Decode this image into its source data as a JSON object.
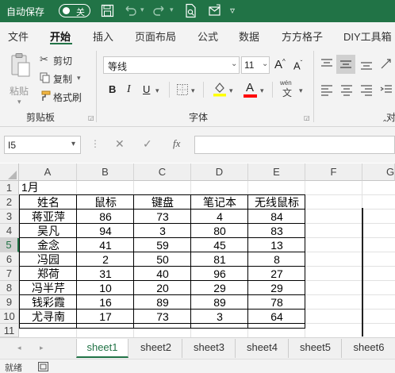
{
  "titlebar": {
    "autosave_label": "自动保存",
    "autosave_state": "关",
    "icons": [
      "save-icon",
      "undo-icon",
      "redo-icon",
      "print-preview-icon",
      "more-icon"
    ]
  },
  "tabs": [
    "文件",
    "开始",
    "插入",
    "页面布局",
    "公式",
    "数据",
    "方方格子",
    "DIY工具箱"
  ],
  "clipboard": {
    "paste": "粘贴",
    "cut": "剪切",
    "copy": "复制",
    "format_painter": "格式刷",
    "group_label": "剪贴板"
  },
  "font": {
    "name": "等线",
    "size": "11",
    "grow": "A",
    "shrink": "A",
    "bold": "B",
    "italic": "I",
    "underline": "U",
    "wen": "wén",
    "wen_char": "文",
    "font_color": "A",
    "group_label": "字体"
  },
  "align_group_label": "对",
  "formula_bar": {
    "name_box": "I5",
    "cancel": "✕",
    "enter": "✓",
    "fx": "fx",
    "value": ""
  },
  "grid": {
    "columns": [
      "A",
      "B",
      "C",
      "D",
      "E",
      "F",
      "G"
    ],
    "rows": [
      "1",
      "2",
      "3",
      "4",
      "5",
      "6",
      "7",
      "8",
      "9",
      "10",
      "11"
    ],
    "title_cell": "1月",
    "headers": [
      "姓名",
      "鼠标",
      "键盘",
      "笔记本",
      "无线鼠标"
    ],
    "data": [
      [
        "蒋亚萍",
        "86",
        "73",
        "4",
        "84"
      ],
      [
        "吴凡",
        "94",
        "3",
        "80",
        "83"
      ],
      [
        "金念",
        "41",
        "59",
        "45",
        "13"
      ],
      [
        "冯园",
        "2",
        "50",
        "81",
        "8"
      ],
      [
        "郑荷",
        "31",
        "40",
        "96",
        "27"
      ],
      [
        "冯半芹",
        "10",
        "20",
        "29",
        "29"
      ],
      [
        "钱彩霞",
        "16",
        "89",
        "89",
        "78"
      ],
      [
        "尤寻南",
        "17",
        "73",
        "3",
        "64"
      ]
    ]
  },
  "sheets": [
    "sheet1",
    "sheet2",
    "sheet3",
    "sheet4",
    "sheet5",
    "sheet6"
  ],
  "active_sheet": "sheet1",
  "status": {
    "ready": "就绪"
  },
  "colors": {
    "accent": "#217346",
    "highlight": "#ffff00",
    "font_color": "#ff0000"
  }
}
